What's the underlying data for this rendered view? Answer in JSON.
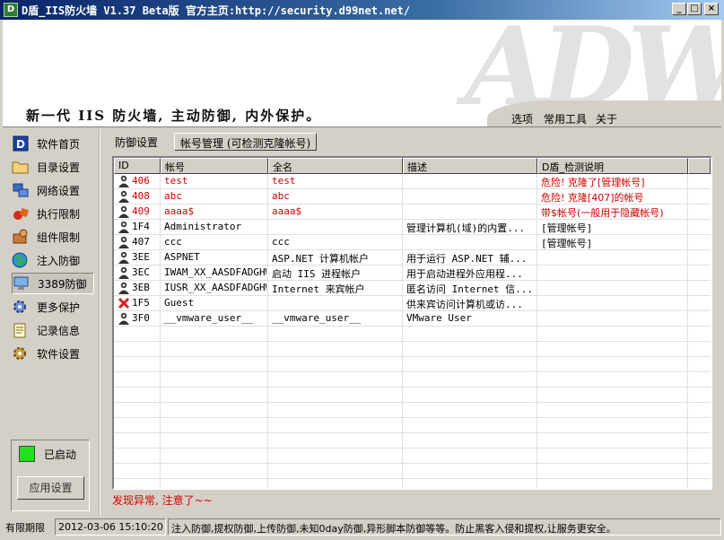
{
  "window": {
    "title": "D盾_IIS防火墙 V1.37 Beta版  官方主页:http://security.d99net.net/",
    "app_icon": "D"
  },
  "banner": {
    "slogan": "新一代 IIS 防火墙, 主动防御, 内外保护。",
    "menu": [
      "选项",
      "常用工具",
      "关于"
    ]
  },
  "sidebar": {
    "items": [
      {
        "label": "软件首页",
        "icon": "d-logo-icon"
      },
      {
        "label": "目录设置",
        "icon": "folder-icon"
      },
      {
        "label": "网络设置",
        "icon": "network-icon"
      },
      {
        "label": "执行限制",
        "icon": "gems-icon"
      },
      {
        "label": "组件限制",
        "icon": "components-icon"
      },
      {
        "label": "注入防御",
        "icon": "globe-icon"
      },
      {
        "label": "3389防御",
        "icon": "remote-desktop-icon"
      },
      {
        "label": "更多保护",
        "icon": "shield-gear-icon"
      },
      {
        "label": "记录信息",
        "icon": "log-icon"
      },
      {
        "label": "软件设置",
        "icon": "settings-gear-icon"
      }
    ],
    "active_index": 6,
    "status": {
      "label": "已启动",
      "led_color": "#22e01d"
    },
    "apply_button": "应用设置"
  },
  "tabs": [
    {
      "label": "防御设置"
    },
    {
      "label": "帐号管理 (可检测克隆帐号)"
    }
  ],
  "accounts": {
    "columns": [
      "ID",
      "帐号",
      "全名",
      "描述",
      "D盾_检测说明"
    ],
    "rows": [
      {
        "id": "406",
        "account": "test",
        "fullname": "test",
        "desc": "",
        "note": "危险! 克隆了[管理帐号]",
        "danger": true,
        "disabled": false
      },
      {
        "id": "408",
        "account": "abc",
        "fullname": "abc",
        "desc": "",
        "note": "危险! 克隆[407]的帐号",
        "danger": true,
        "disabled": false
      },
      {
        "id": "409",
        "account": "aaaa$",
        "fullname": "aaaa$",
        "desc": "",
        "note": "带$帐号(一般用于隐藏帐号)",
        "danger": true,
        "disabled": false
      },
      {
        "id": "1F4",
        "account": "Administrator",
        "fullname": "",
        "desc": "管理计算机(域)的内置...",
        "note": "[管理帐号]",
        "danger": false,
        "disabled": false
      },
      {
        "id": "407",
        "account": "ccc",
        "fullname": "ccc",
        "desc": "",
        "note": "[管理帐号]",
        "danger": false,
        "disabled": false
      },
      {
        "id": "3EE",
        "account": "ASPNET",
        "fullname": "ASP.NET 计算机帐户",
        "desc": "用于运行 ASP.NET 辅...",
        "note": "",
        "danger": false,
        "disabled": false
      },
      {
        "id": "3EC",
        "account": "IWAM_XX_AASDFADGHW",
        "fullname": "启动 IIS 进程帐户",
        "desc": "用于启动进程外应用程...",
        "note": "",
        "danger": false,
        "disabled": false
      },
      {
        "id": "3EB",
        "account": "IUSR_XX_AASDFADGHW",
        "fullname": "Internet 来宾帐户",
        "desc": "匿名访问 Internet 信...",
        "note": "",
        "danger": false,
        "disabled": false
      },
      {
        "id": "1F5",
        "account": "Guest",
        "fullname": "",
        "desc": "供来宾访问计算机或访...",
        "note": "",
        "danger": false,
        "disabled": true
      },
      {
        "id": "3F0",
        "account": "__vmware_user__",
        "fullname": "__vmware_user__",
        "desc": "VMware User",
        "note": "",
        "danger": false,
        "disabled": false
      }
    ],
    "danger_color": "#d40000"
  },
  "warning": "发现异常, 注意了~~",
  "statusbar": {
    "label": "有限期限",
    "datetime": "2012-03-06 15:10:20",
    "message": "注入防御,提权防御,上传防御,未知0day防御,异形脚本防御等等。防止黑客入侵和提权,让服务更安全。"
  }
}
